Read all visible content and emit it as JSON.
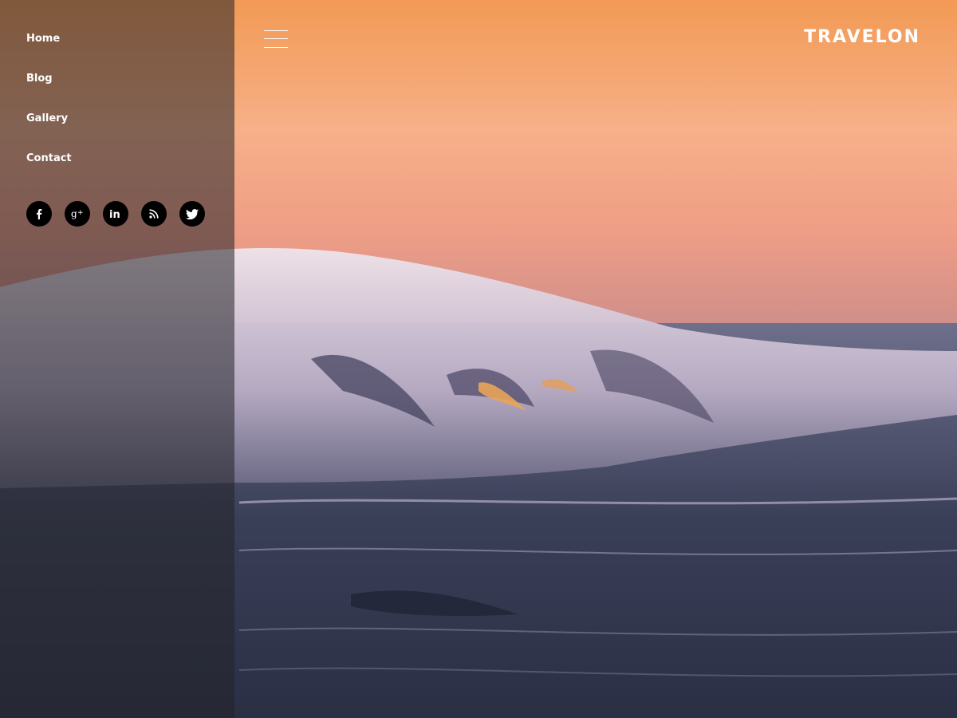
{
  "brand": {
    "name": "TRAVELON"
  },
  "nav": {
    "items": [
      {
        "label": "Home"
      },
      {
        "label": "Blog"
      },
      {
        "label": "Gallery"
      },
      {
        "label": "Contact"
      }
    ]
  },
  "social": {
    "icons": [
      "facebook-icon",
      "google-plus-icon",
      "linkedin-icon",
      "rss-icon",
      "twitter-icon"
    ]
  },
  "menu_toggle": {
    "icon": "hamburger-icon"
  },
  "hero": {
    "image": "ocean-wave-sunset"
  },
  "colors": {
    "sky_top": "#f29a55",
    "sky_mid": "#ef9e86",
    "sea": "#343a52",
    "sidebar_overlay": "rgba(35,35,40,0.55)",
    "text": "#ffffff",
    "social_circle": "#000000"
  }
}
